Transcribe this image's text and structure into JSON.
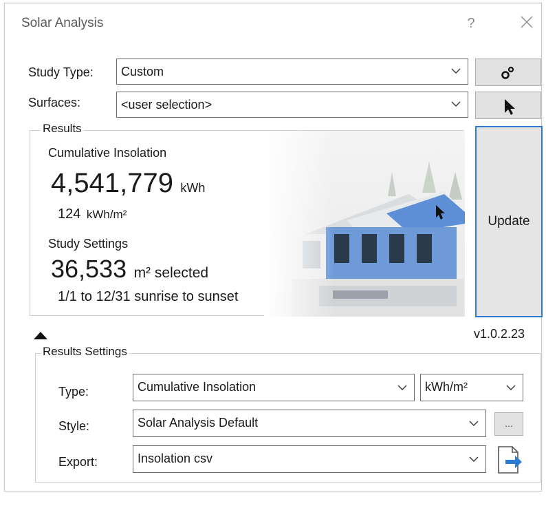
{
  "dialog": {
    "title": "Solar Analysis",
    "help_label": "?",
    "accent_color": "#2b7bd1"
  },
  "study": {
    "study_type_label": "Study Type:",
    "study_type_value": "Custom",
    "surfaces_label": "Surfaces:",
    "surfaces_value": "<user selection>"
  },
  "results": {
    "legend": "Results",
    "cumulative_label": "Cumulative Insolation",
    "total_value": "4,541,779",
    "total_unit": "kWh",
    "per_area_value": "124",
    "per_area_unit": "kWh/m²",
    "study_settings_label": "Study Settings",
    "area_value": "36,533",
    "area_unit": "m² selected",
    "date_range": "1/1 to 12/31 sunrise to sunset"
  },
  "update": {
    "label": "Update"
  },
  "version": "v1.0.2.23",
  "results_settings": {
    "legend": "Results Settings",
    "type_label": "Type:",
    "type_value": "Cumulative Insolation",
    "unit_value": "kWh/m²",
    "style_label": "Style:",
    "style_value": "Solar Analysis Default",
    "style_more_label": "...",
    "export_label": "Export:",
    "export_value": "Insolation csv"
  }
}
